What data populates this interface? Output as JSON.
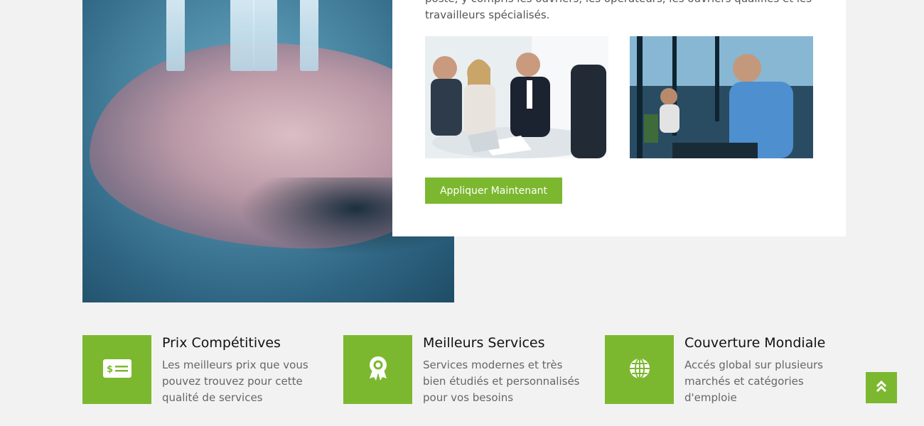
{
  "about": {
    "intro_text": "poste, y compris les ouvriers, les opérateurs, les ouvriers qualifiés et les travailleurs spécialisés.",
    "apply_button": "Appliquer Maintenant"
  },
  "features": [
    {
      "title": "Prix Compétitives",
      "description": "Les meilleurs prix que vous pouvez trouvez pour cette qualité de services",
      "icon": "money-check-icon"
    },
    {
      "title": "Meilleurs Services",
      "description": "Services modernes et très bien étudiés et personnalisés pour vos besoins",
      "icon": "award-icon"
    },
    {
      "title": "Couverture Mondiale",
      "description": "Accés global sur plusieurs marchés et catégories d'emploie",
      "icon": "globe-icon"
    }
  ],
  "colors": {
    "accent": "#7cb82f",
    "background": "#f2f2f2",
    "card": "#ffffff"
  }
}
